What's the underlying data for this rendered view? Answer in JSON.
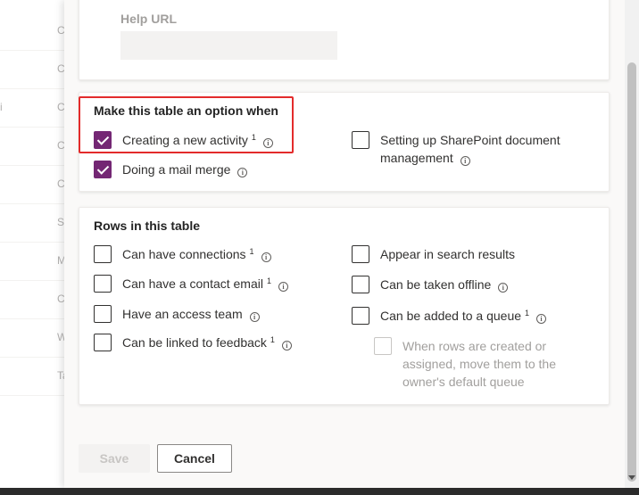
{
  "background_list": {
    "rows": [
      {
        "edge": "",
        "text": "C"
      },
      {
        "edge": "",
        "text": "C"
      },
      {
        "edge": "i",
        "text": "C"
      },
      {
        "edge": "",
        "text": "C"
      },
      {
        "edge": "",
        "text": "C"
      },
      {
        "edge": "",
        "text": "S"
      },
      {
        "edge": "",
        "text": "M"
      },
      {
        "edge": "",
        "text": "C"
      },
      {
        "edge": "",
        "text": "W"
      },
      {
        "edge": "",
        "text": "Ta"
      }
    ]
  },
  "help": {
    "label": "Help URL",
    "value": ""
  },
  "option_section": {
    "title": "Make this table an option when",
    "items": [
      {
        "label": "Creating a new activity",
        "footnote": "1",
        "checked": true
      },
      {
        "label": "Doing a mail merge",
        "footnote": "",
        "checked": true
      },
      {
        "label": "Setting up SharePoint document management",
        "footnote": "",
        "checked": false
      }
    ]
  },
  "rows_section": {
    "title": "Rows in this table",
    "items": [
      {
        "label": "Can have connections",
        "footnote": "1",
        "checked": false
      },
      {
        "label": "Can have a contact email",
        "footnote": "1",
        "checked": false
      },
      {
        "label": "Have an access team",
        "footnote": "",
        "checked": false
      },
      {
        "label": "Can be linked to feedback",
        "footnote": "1",
        "checked": false
      },
      {
        "label": "Appear in search results",
        "footnote": "",
        "checked": false
      },
      {
        "label": "Can be taken offline",
        "footnote": "",
        "checked": false
      },
      {
        "label": "Can be added to a queue",
        "footnote": "1",
        "checked": false
      },
      {
        "label": "When rows are created or assigned, move them to the owner's default queue",
        "footnote": "",
        "checked": false,
        "disabled": true
      }
    ]
  },
  "info_icon_glyph": "i",
  "footer": {
    "save_label": "Save",
    "cancel_label": "Cancel"
  },
  "colors": {
    "accent": "#742774",
    "highlight_border": "#e32b2b"
  }
}
